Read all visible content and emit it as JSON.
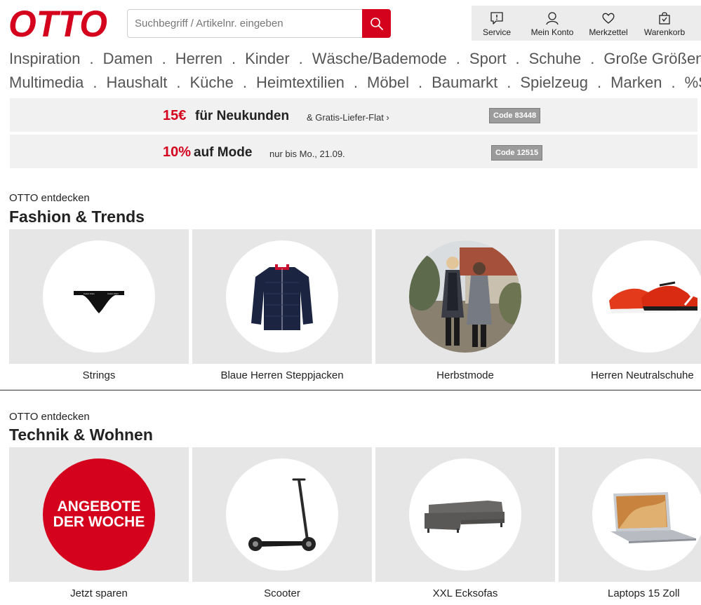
{
  "brand": {
    "logo_text": "OTTO",
    "accent_color": "#d4021d"
  },
  "search": {
    "placeholder": "Suchbegriff / Artikelnr. eingeben",
    "value": ""
  },
  "header_icons": [
    {
      "label": "Service",
      "icon": "service-icon"
    },
    {
      "label": "Mein Konto",
      "icon": "user-icon"
    },
    {
      "label": "Merkzettel",
      "icon": "heart-icon"
    },
    {
      "label": "Warenkorb",
      "icon": "cart-icon"
    }
  ],
  "nav": {
    "row1": [
      "Inspiration",
      "Damen",
      "Herren",
      "Kinder",
      "Wäsche/Bademode",
      "Sport",
      "Schuhe",
      "Große Größen"
    ],
    "row2": [
      "Multimedia",
      "Haushalt",
      "Küche",
      "Heimtextilien",
      "Möbel",
      "Baumarkt",
      "Spielzeug",
      "Marken",
      "%Sale%"
    ],
    "separator": "."
  },
  "promos": [
    {
      "amount": "15€",
      "headline": "für Neukunden",
      "sub": "& Gratis-Liefer-Flat ›",
      "code": "Code 83448"
    },
    {
      "amount": "10%",
      "headline": "auf Mode",
      "sub": "nur bis Mo., 21.09.",
      "code": "Code 12515"
    }
  ],
  "sections": [
    {
      "eyebrow": "OTTO entdecken",
      "title": "Fashion & Trends",
      "tiles": [
        {
          "label": "Strings",
          "image": "strings-product"
        },
        {
          "label": "Blaue Herren Steppjacken",
          "image": "jacket-product"
        },
        {
          "label": "Herbstmode",
          "image": "autumn-fashion-photo"
        },
        {
          "label": "Herren Neutralschuhe",
          "image": "sneaker-product"
        }
      ]
    },
    {
      "eyebrow": "OTTO entdecken",
      "title": "Technik & Wohnen",
      "tiles": [
        {
          "label": "Jetzt sparen",
          "image": "deals-badge",
          "badge_text": "ANGEBOTE DER WOCHE"
        },
        {
          "label": "Scooter",
          "image": "scooter-product"
        },
        {
          "label": "XXL Ecksofas",
          "image": "sofa-product"
        },
        {
          "label": "Laptops 15 Zoll",
          "image": "laptop-product"
        }
      ]
    }
  ]
}
